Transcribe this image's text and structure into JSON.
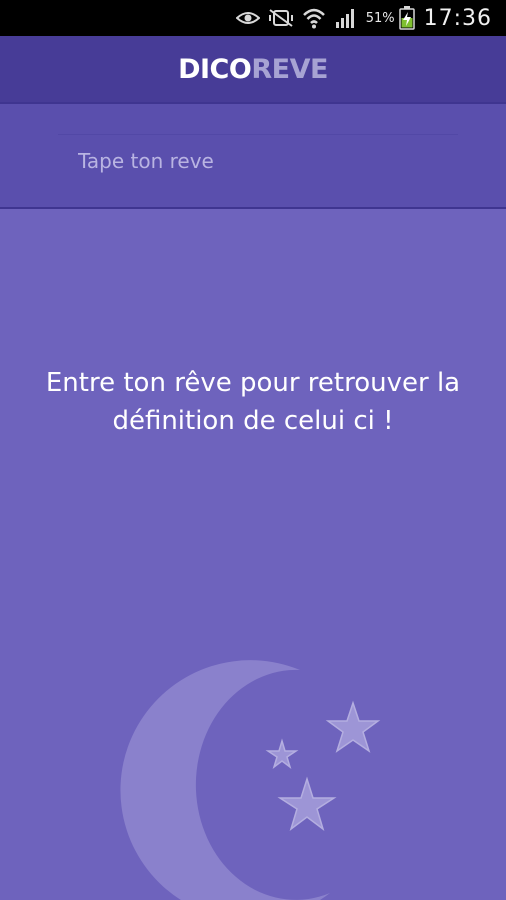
{
  "status_bar": {
    "battery_percent": "51%",
    "time": "17:36",
    "icons": [
      "eye-icon",
      "mute-icon",
      "wifi-icon",
      "signal-icon",
      "battery-charging-icon"
    ]
  },
  "app_bar": {
    "title_part_1": "DICO",
    "title_part_2": "REVE"
  },
  "search": {
    "placeholder": "Tape ton reve",
    "value": ""
  },
  "message": {
    "line_1": "Entre ton rêve pour retrouver la",
    "line_2": "définition de celui ci !"
  },
  "decoration": {
    "icons": [
      "moon-icon",
      "star-icon"
    ]
  },
  "colors": {
    "background": "#6e63bd",
    "app_bar": "#473c97",
    "search_panel": "#5a4fad",
    "title_secondary": "#a7a3d3",
    "status_bar": "#000000"
  }
}
